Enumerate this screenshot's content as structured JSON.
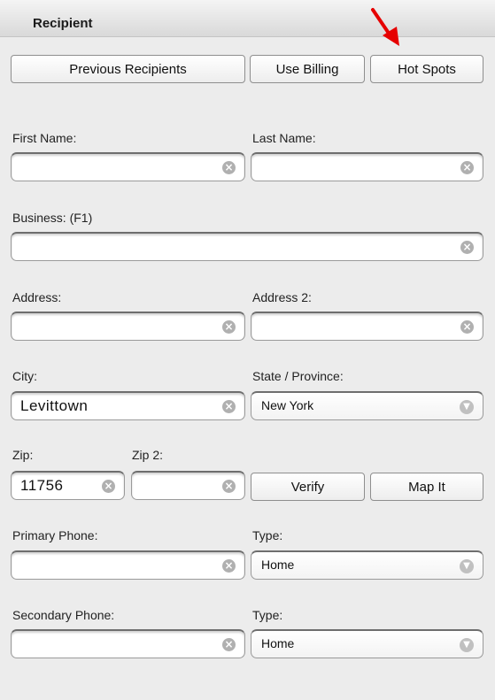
{
  "header": {
    "title": "Recipient"
  },
  "buttons": {
    "previous_recipients": "Previous Recipients",
    "use_billing": "Use Billing",
    "hot_spots": "Hot Spots",
    "verify": "Verify",
    "map_it": "Map It"
  },
  "fields": {
    "first_name": {
      "label": "First Name:",
      "value": ""
    },
    "last_name": {
      "label": "Last Name:",
      "value": ""
    },
    "business": {
      "label": "Business: (F1)",
      "value": ""
    },
    "address": {
      "label": "Address:",
      "value": ""
    },
    "address2": {
      "label": "Address 2:",
      "value": ""
    },
    "city": {
      "label": "City:",
      "value": "Levittown"
    },
    "state": {
      "label": "State / Province:",
      "value": "New York"
    },
    "zip": {
      "label": "Zip:",
      "value": "11756"
    },
    "zip2": {
      "label": "Zip 2:",
      "value": ""
    },
    "primary_phone": {
      "label": "Primary Phone:",
      "value": ""
    },
    "primary_type": {
      "label": "Type:",
      "value": "Home"
    },
    "secondary_phone": {
      "label": "Secondary Phone:",
      "value": ""
    },
    "secondary_type": {
      "label": "Type:",
      "value": "Home"
    }
  },
  "icons": {
    "clear": "clear-x-icon",
    "dropdown": "chevron-down-icon",
    "pointer": "red-arrow-icon"
  },
  "colors": {
    "arrow": "#e60000",
    "background": "#ececec"
  }
}
